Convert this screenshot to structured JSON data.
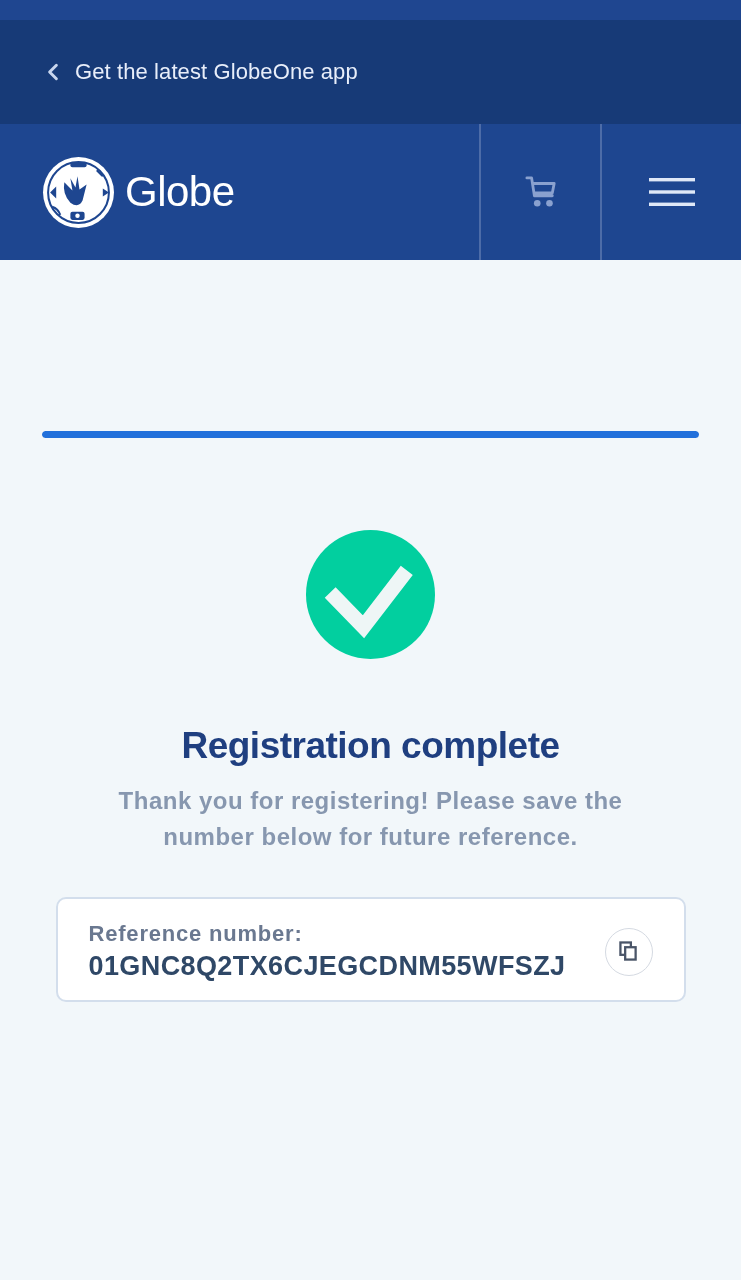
{
  "app_banner": {
    "text": "Get the latest GlobeOne app"
  },
  "header": {
    "brand": "Globe"
  },
  "progress": {
    "level": 1
  },
  "result": {
    "title": "Registration complete",
    "message": "Thank you for registering! Please save the number below for future reference."
  },
  "reference": {
    "label": "Reference number:",
    "value": "01GNC8Q2TX6CJEGCDNM55WFSZJ"
  }
}
